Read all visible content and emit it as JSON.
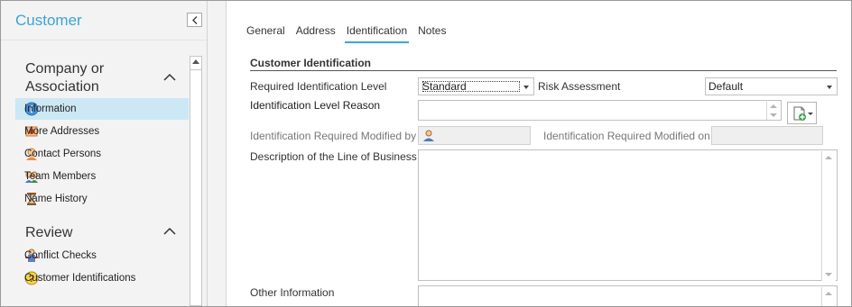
{
  "sidebar": {
    "title": "Customer",
    "sections": [
      {
        "title": "Company or Association",
        "items": [
          {
            "label": "Information",
            "icon": "info-icon"
          },
          {
            "label": "More Addresses",
            "icon": "address-icon"
          },
          {
            "label": "Contact Persons",
            "icon": "contact-person-icon"
          },
          {
            "label": "Team Members",
            "icon": "team-members-icon"
          },
          {
            "label": "Name History",
            "icon": "hourglass-icon"
          }
        ]
      },
      {
        "title": "Review",
        "items": [
          {
            "label": "Conflict Checks",
            "icon": "conflict-check-icon"
          },
          {
            "label": "Customer Identifications",
            "icon": "question-icon"
          }
        ]
      }
    ],
    "active_item": "Information"
  },
  "tabs": [
    "General",
    "Address",
    "Identification",
    "Notes"
  ],
  "active_tab": "Identification",
  "section_title": "Customer Identification",
  "form": {
    "required_level_label": "Required Identification Level",
    "required_level_value": "Standard",
    "risk_label": "Risk Assessment",
    "risk_value": "Default",
    "reason_label": "Identification Level Reason",
    "reason_value": "",
    "modified_by_label": "Identification Required Modified by",
    "modified_on_label": "Identification Required Modified on",
    "modified_on_value": "",
    "description_label": "Description of the Line of Business",
    "description_value": "",
    "other_label": "Other Information",
    "other_value": ""
  },
  "colors": {
    "accent": "#3aa4d8",
    "active_item_bg": "#cce8f4"
  }
}
